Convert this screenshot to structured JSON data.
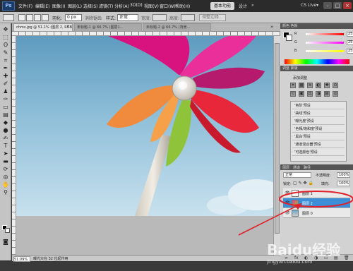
{
  "app": {
    "logo": "Ps",
    "menus": [
      "文件(F)",
      "编辑(E)",
      "图像(I)",
      "图层(L)",
      "选择(S)",
      "滤镜(T)",
      "分析(A)",
      "3D(D)",
      "视图(V)",
      "窗口(W)",
      "帮助(H)"
    ],
    "workspace_button": "基本功能",
    "workspace_menu": "设计",
    "workspace_more": "»",
    "cs_live": "CS Live▾",
    "window_controls": [
      "–",
      "□",
      "×"
    ]
  },
  "options_bar": {
    "feather_label": "羽化:",
    "feather_value": "0 px",
    "antialias_label": "消除锯齿",
    "style_label": "样式:",
    "style_value": "正常",
    "width_label": "宽度:",
    "height_label": "高度:",
    "refine_edge": "调整边缘..."
  },
  "document": {
    "tabs": [
      {
        "title": "chmv.jpg @ 51.1% (图层 2, RGB/8#)",
        "close": "×"
      },
      {
        "title": "未标题-1 @ 66.7% (图层1...",
        "close": "×"
      },
      {
        "title": "未标题-2 @ 66.7% (背景...",
        "close": "×"
      }
    ],
    "tab_overflow": "»",
    "zoom": "51.09%",
    "status_info": "曝光只在 32 位起作用"
  },
  "panels": {
    "color_header": "颜色  色板",
    "channels": [
      {
        "label": "R",
        "value": "255",
        "color": "#ff0000"
      },
      {
        "label": "G",
        "value": "255",
        "color": "#ff00ff"
      },
      {
        "label": "B",
        "value": "255",
        "color": "#ffff00"
      }
    ],
    "adjust_header": "调整  蒙版",
    "adjust_title": "添加调整",
    "adjust_icons": [
      "☀",
      "▦",
      "≋",
      "◐",
      "▽",
      "▣",
      "⚖",
      "◑",
      "▤",
      "◎",
      "✚",
      "⊙"
    ],
    "presets": [
      "'色阶'预设",
      "'曲线'预设",
      "'曝光度'预设",
      "'色相/饱和度'预设",
      "'黑白'预设",
      "'通道混合器'预设",
      "'可选颜色'预设"
    ],
    "layers_tabs": [
      "图层",
      "通道",
      "路径"
    ],
    "blend_mode": "正常",
    "opacity_label": "不透明度:",
    "opacity_value": "100%",
    "lock_label": "锁定:",
    "fill_label": "填充:",
    "fill_value": "100%",
    "layers": [
      {
        "name": "图层 1",
        "active": false
      },
      {
        "name": "图层 2",
        "active": true
      },
      {
        "name": "图层 0",
        "active": false
      }
    ],
    "layer_bottom_icons": [
      "∞",
      "fx",
      "◐",
      "◑",
      "▭",
      "▤",
      "🗑"
    ]
  },
  "watermark": {
    "brand": "Baidu经验",
    "url": "jingyan.baidu.com"
  }
}
